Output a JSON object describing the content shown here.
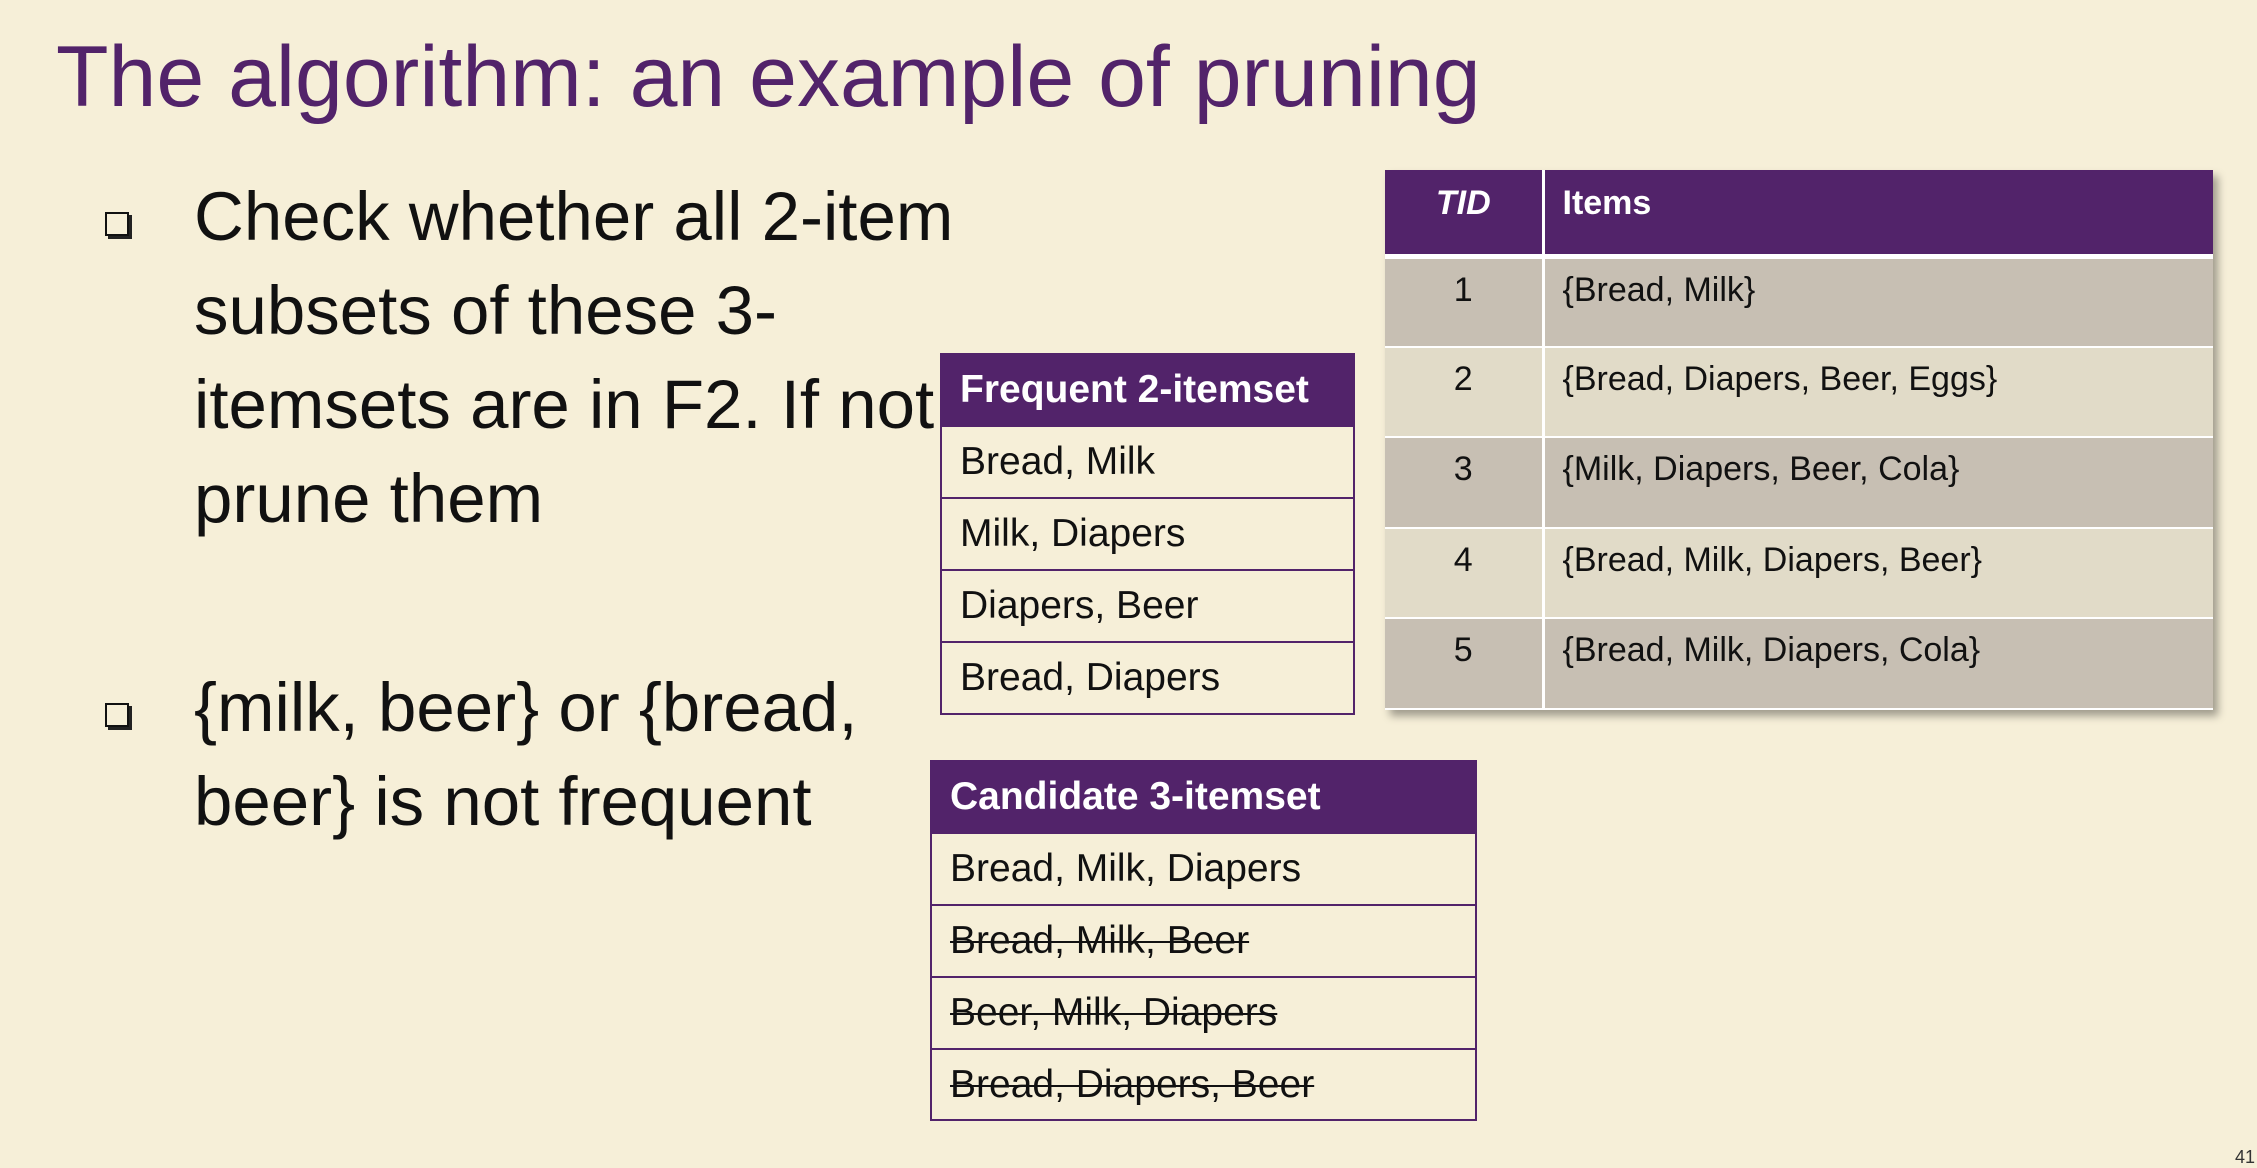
{
  "slide": {
    "title": "The algorithm: an example of pruning",
    "page_number": "41"
  },
  "bullets": [
    {
      "text": "Check whether all 2-item subsets of these 3-itemsets are in F2. If not, prune them"
    },
    {
      "text": "{milk, beer} or {bread, beer} is not frequent"
    }
  ],
  "frequent_2_itemset": {
    "header": "Frequent 2-itemset",
    "rows": [
      "Bread, Milk",
      "Milk, Diapers",
      "Diapers, Beer",
      "Bread, Diapers"
    ]
  },
  "candidate_3_itemset": {
    "header": "Candidate 3-itemset",
    "rows": [
      {
        "text": "Bread, Milk, Diapers",
        "struck": false
      },
      {
        "text": "Bread, Milk, Beer",
        "struck": true
      },
      {
        "text": "Beer, Milk, Diapers",
        "struck": true
      },
      {
        "text": "Bread, Diapers, Beer",
        "struck": true
      }
    ]
  },
  "transactions": {
    "headers": {
      "tid": "TID",
      "items": "Items"
    },
    "rows": [
      {
        "tid": "1",
        "items": "{Bread, Milk}"
      },
      {
        "tid": "2",
        "items": "{Bread, Diapers, Beer, Eggs}"
      },
      {
        "tid": "3",
        "items": "{Milk, Diapers, Beer, Cola}"
      },
      {
        "tid": "4",
        "items": "{Bread, Milk, Diapers, Beer}"
      },
      {
        "tid": "5",
        "items": "{Bread, Milk, Diapers, Cola}"
      }
    ]
  },
  "colors": {
    "accent": "#52236a",
    "background": "#f6efd8",
    "row_dark": "#c7bfb3",
    "row_light": "#e1dbc8"
  }
}
